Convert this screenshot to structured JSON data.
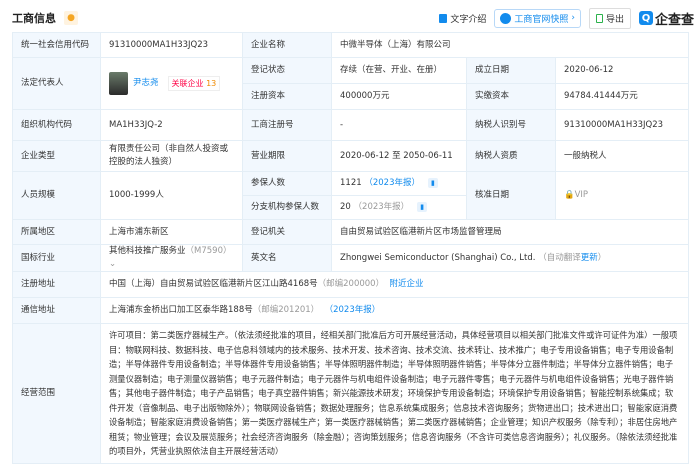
{
  "header": {
    "title": "工商信息",
    "text_intro": "文字介绍",
    "snapshot": "工商官网快照",
    "export": "导出",
    "logo": "企查查"
  },
  "rows": {
    "credit_code_label": "统一社会信用代码",
    "credit_code": "91310000MA1H33JQ23",
    "name_label": "企业名称",
    "name": "中微半导体（上海）有限公司",
    "legal_label": "法定代表人",
    "legal_name": "尹志尧",
    "related_label": "关联企业",
    "related_count": "13",
    "status_label": "登记状态",
    "status": "存续（在营、开业、在册）",
    "founded_label": "成立日期",
    "founded": "2020-06-12",
    "reg_cap_label": "注册资本",
    "reg_cap": "400000万元",
    "paid_cap_label": "实缴资本",
    "paid_cap": "94784.41444万元",
    "org_code_label": "组织机构代码",
    "org_code": "MA1H33JQ-2",
    "reg_no_label": "工商注册号",
    "reg_no": "-",
    "tax_id_label": "纳税人识别号",
    "tax_id": "91310000MA1H33JQ23",
    "type_label": "企业类型",
    "type": "有限责任公司（非自然人投资或控股的法人独资）",
    "term_label": "营业期限",
    "term": "2020-06-12 至 2050-06-11",
    "tax_qual_label": "纳税人资质",
    "tax_qual": "一般纳税人",
    "staff_label": "人员规模",
    "staff": "1000-1999人",
    "insured_label": "参保人数",
    "insured": "1121",
    "insured_year": "（2023年报）",
    "branch_insured_label": "分支机构参保人数",
    "branch_insured": "20",
    "branch_insured_year": "（2023年报）",
    "approval_label": "核准日期",
    "approval_vip": "VIP",
    "region_label": "所属地区",
    "region": "上海市浦东新区",
    "authority_label": "登记机关",
    "authority": "自由贸易试验区临港新片区市场监督管理局",
    "industry_label": "国标行业",
    "industry": "其他科技推广服务业",
    "industry_code": "（M7590）",
    "en_name_label": "英文名",
    "en_name": "Zhongwei Semiconductor (Shanghai) Co., Ltd.",
    "auto_translate": "（自动翻译",
    "update": "更新",
    "close_paren": "）",
    "reg_addr_label": "注册地址",
    "reg_addr": "中国（上海）自由贸易试验区临港新片区江山路4168号",
    "reg_zip": "（邮编200000）",
    "nearby": "附近企业",
    "mail_addr_label": "通信地址",
    "mail_addr": "上海浦东金桥出口加工区泰华路188号",
    "mail_zip": "（邮编201201）",
    "mail_year": "（2023年报）",
    "scope_label": "经营范围",
    "scope": "许可项目：第二类医疗器械生产。（依法须经批准的项目，经相关部门批准后方可开展经营活动，具体经营项目以相关部门批准文件或许可证件为准）一般项目：物联网科技、数据科技、电子信息科领域内的技术服务、技术开发、技术咨询、技术交流、技术转让、技术推广；电子专用设备销售；电子专用设备制造；半导体器件专用设备制造；半导体器件专用设备销售；半导体照明器件制造；半导体照明器件销售；半导体分立器件制造；半导体分立器件销售；电子测量仪器制造；电子测量仪器销售；电子元器件制造；电子元器件与机电组件设备制造；电子元器件零售；电子元器件与机电组件设备销售；光电子器件销售；其他电子器件制造；电子产品销售；电子真空器件销售；新兴能源技术研发；环境保护专用设备制造；环境保护专用设备销售；智能控制系统集成；软件开发（音像制品、电子出版物除外）；物联网设备销售；数据处理服务；信息系统集成服务；信息技术咨询服务；货物进出口；技术进出口；智能家庭消费设备制造；智能家庭消费设备销售；第一类医疗器械生产；第一类医疗器械销售；第二类医疗器械销售；企业管理；知识产权服务（除专利）；非居住房地产租赁；物业管理；会议及展览服务；社会经济咨询服务（除金融）；咨询策划服务；信息咨询服务（不含许可类信息咨询服务）；礼仪服务。（除依法须经批准的项目外，凭营业执照依法自主开展经营活动）"
  }
}
